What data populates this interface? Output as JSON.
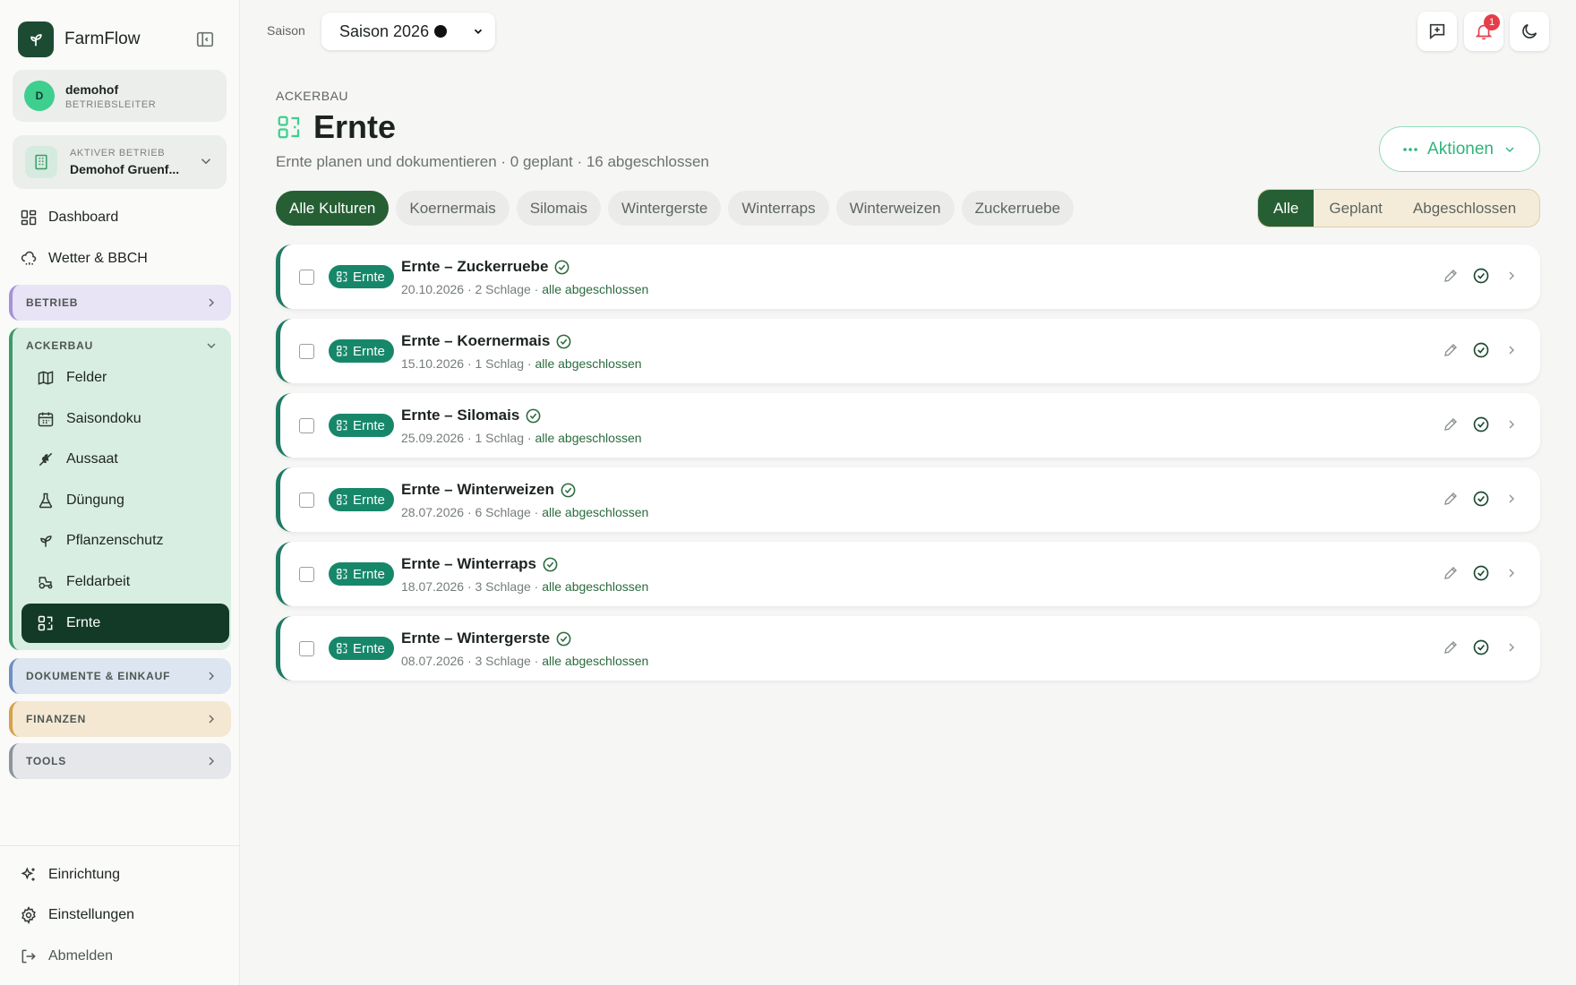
{
  "app": {
    "name": "FarmFlow"
  },
  "user": {
    "initial": "D",
    "name": "demohof",
    "role": "BETRIEBSLEITER"
  },
  "farm": {
    "label": "AKTIVER BETRIEB",
    "name": "Demohof Gruenf..."
  },
  "nav": {
    "dashboard": "Dashboard",
    "weather": "Wetter & BBCH"
  },
  "groups": {
    "betrieb": "BETRIEB",
    "ackerbau": "ACKERBAU",
    "dokumente": "DOKUMENTE & EINKAUF",
    "finanzen": "FINANZEN",
    "tools": "TOOLS"
  },
  "ackerbau_items": [
    "Felder",
    "Saisondoku",
    "Aussaat",
    "Düngung",
    "Pflanzenschutz",
    "Feldarbeit",
    "Ernte"
  ],
  "footer_nav": {
    "setup": "Einrichtung",
    "settings": "Einstellungen",
    "logout": "Abmelden"
  },
  "topbar": {
    "season_label": "Saison",
    "season_value": "Saison 2026",
    "notification_count": "1"
  },
  "page": {
    "eyebrow": "ACKERBAU",
    "title": "Ernte",
    "subtitle": "Ernte planen und dokumentieren · 0 geplant · 16 abgeschlossen",
    "actions_label": "Aktionen"
  },
  "crop_filters": [
    "Alle Kulturen",
    "Koernermais",
    "Silomais",
    "Wintergerste",
    "Winterraps",
    "Winterweizen",
    "Zuckerruebe"
  ],
  "status_filters": [
    "Alle",
    "Geplant",
    "Abgeschlossen"
  ],
  "rows": [
    {
      "badge": "Ernte",
      "title": "Ernte – Zuckerruebe",
      "meta": "20.10.2026 · 2 Schlage ·",
      "status": "alle abgeschlossen"
    },
    {
      "badge": "Ernte",
      "title": "Ernte – Koernermais",
      "meta": "15.10.2026 · 1 Schlag ·",
      "status": "alle abgeschlossen"
    },
    {
      "badge": "Ernte",
      "title": "Ernte – Silomais",
      "meta": "25.09.2026 · 1 Schlag ·",
      "status": "alle abgeschlossen"
    },
    {
      "badge": "Ernte",
      "title": "Ernte – Winterweizen",
      "meta": "28.07.2026 · 6 Schlage ·",
      "status": "alle abgeschlossen"
    },
    {
      "badge": "Ernte",
      "title": "Ernte – Winterraps",
      "meta": "18.07.2026 · 3 Schlage ·",
      "status": "alle abgeschlossen"
    },
    {
      "badge": "Ernte",
      "title": "Ernte – Wintergerste",
      "meta": "08.07.2026 · 3 Schlage ·",
      "status": "alle abgeschlossen"
    }
  ],
  "colors": {
    "brand": "#1d4a33",
    "accent": "#3ecf8e",
    "active_chip": "#275f34",
    "badge": "#17876a"
  }
}
